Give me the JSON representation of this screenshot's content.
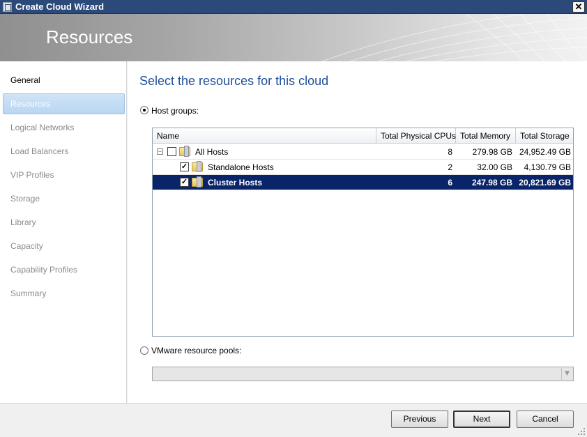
{
  "window": {
    "title": "Create Cloud Wizard",
    "close_glyph": "✕"
  },
  "header": {
    "title": "Resources"
  },
  "nav": {
    "items": [
      {
        "label": "General",
        "state": "current"
      },
      {
        "label": "Resources",
        "state": "selected"
      },
      {
        "label": "Logical Networks",
        "state": "pending"
      },
      {
        "label": "Load Balancers",
        "state": "pending"
      },
      {
        "label": "VIP Profiles",
        "state": "pending"
      },
      {
        "label": "Storage",
        "state": "pending"
      },
      {
        "label": "Library",
        "state": "pending"
      },
      {
        "label": "Capacity",
        "state": "pending"
      },
      {
        "label": "Capability Profiles",
        "state": "pending"
      },
      {
        "label": "Summary",
        "state": "pending"
      }
    ]
  },
  "main": {
    "heading": "Select the resources for this cloud",
    "host_groups_option": {
      "label": "Host groups:",
      "checked": true
    },
    "vmware_option": {
      "label": "VMware resource pools:",
      "checked": false
    },
    "vmware_select": {
      "value": ""
    }
  },
  "grid": {
    "columns": [
      "Name",
      "Total Physical CPUs",
      "Total Memory",
      "Total Storage"
    ],
    "rows": [
      {
        "name": "All Hosts",
        "cpus": "8",
        "memory": "279.98 GB",
        "storage": "24,952.49 GB",
        "checked": false,
        "expander": "−",
        "selected": false
      },
      {
        "name": "Standalone Hosts",
        "cpus": "2",
        "memory": "32.00 GB",
        "storage": "4,130.79 GB",
        "checked": true,
        "selected": false
      },
      {
        "name": "Cluster Hosts",
        "cpus": "6",
        "memory": "247.98 GB",
        "storage": "20,821.69 GB",
        "checked": true,
        "selected": true
      }
    ]
  },
  "footer": {
    "previous": "Previous",
    "next": "Next",
    "cancel": "Cancel"
  },
  "colors": {
    "accent": "#1f4e9c",
    "selection": "#0a246a",
    "titlebar": "#2b4a7a"
  },
  "icons": [
    "app-icon",
    "close-icon",
    "folder-icon",
    "dropdown-arrow-icon",
    "resize-grip-icon"
  ]
}
